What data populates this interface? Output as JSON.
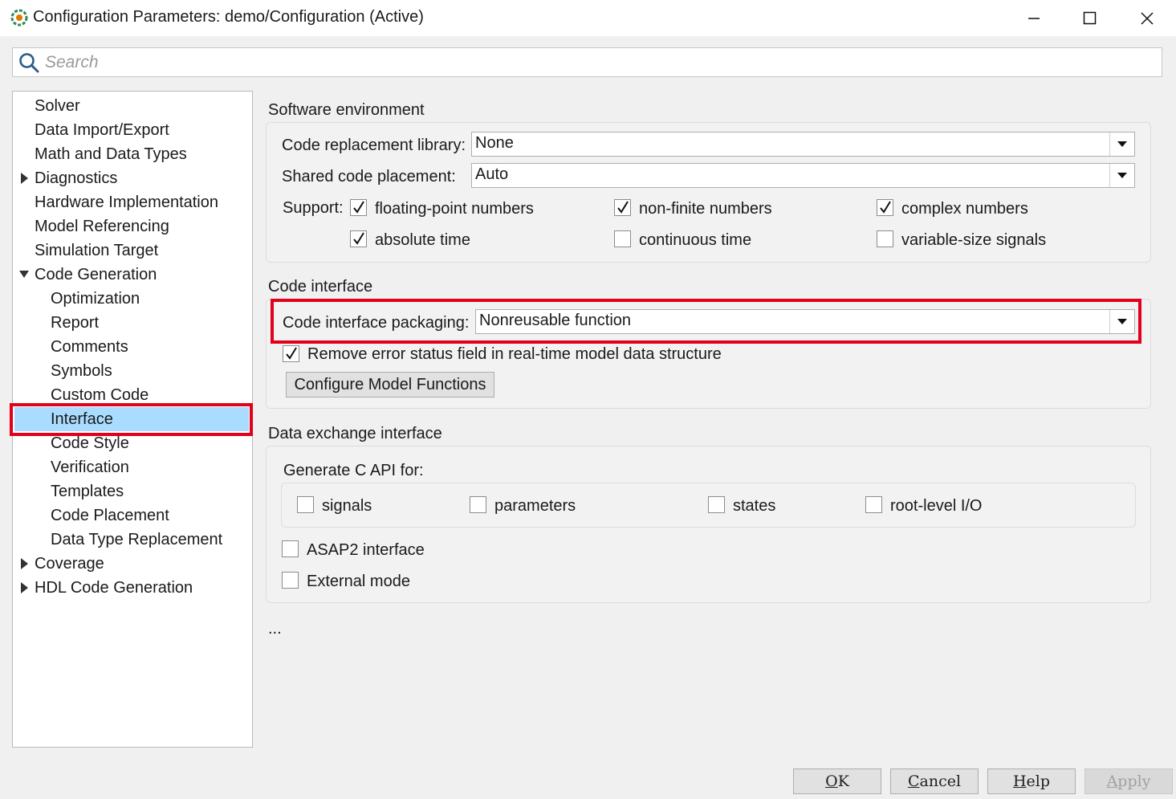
{
  "window": {
    "title": "Configuration Parameters: demo/Configuration (Active)"
  },
  "search": {
    "placeholder": "Search"
  },
  "tree": {
    "items": [
      {
        "label": "Solver"
      },
      {
        "label": "Data Import/Export"
      },
      {
        "label": "Math and Data Types"
      },
      {
        "label": "Diagnostics",
        "expander": "collapsed"
      },
      {
        "label": "Hardware Implementation"
      },
      {
        "label": "Model Referencing"
      },
      {
        "label": "Simulation Target"
      },
      {
        "label": "Code Generation",
        "expander": "expanded"
      },
      {
        "label": "Optimization"
      },
      {
        "label": "Report"
      },
      {
        "label": "Comments"
      },
      {
        "label": "Symbols"
      },
      {
        "label": "Custom Code"
      },
      {
        "label": "Interface",
        "selected": true
      },
      {
        "label": "Code Style"
      },
      {
        "label": "Verification"
      },
      {
        "label": "Templates"
      },
      {
        "label": "Code Placement"
      },
      {
        "label": "Data Type Replacement"
      },
      {
        "label": "Coverage",
        "expander": "collapsed"
      },
      {
        "label": "HDL Code Generation",
        "expander": "collapsed"
      }
    ]
  },
  "software_env": {
    "title": "Software environment",
    "crl_label": "Code replacement library:",
    "crl_value": "None",
    "shared_label": "Shared code placement:",
    "shared_value": "Auto",
    "support_label": "Support:",
    "checkboxes": [
      {
        "label": "floating-point numbers",
        "checked": true
      },
      {
        "label": "non-finite numbers",
        "checked": true
      },
      {
        "label": "complex numbers",
        "checked": true
      },
      {
        "label": "absolute time",
        "checked": true
      },
      {
        "label": "continuous time",
        "checked": false
      },
      {
        "label": "variable-size signals",
        "checked": false
      }
    ]
  },
  "code_interface": {
    "title": "Code interface",
    "packaging_label": "Code interface packaging:",
    "packaging_value": "Nonreusable function",
    "remove_error_label": "Remove error status field in real-time model data structure",
    "remove_error_checked": true,
    "configure_button": "Configure Model Functions"
  },
  "data_exchange": {
    "title": "Data exchange interface",
    "capi_label": "Generate C API for:",
    "capi_options": [
      {
        "label": "signals",
        "checked": false
      },
      {
        "label": "parameters",
        "checked": false
      },
      {
        "label": "states",
        "checked": false
      },
      {
        "label": "root-level I/O",
        "checked": false
      }
    ],
    "asap2_label": "ASAP2 interface",
    "asap2_checked": false,
    "external_label": "External mode",
    "external_checked": false
  },
  "ellipsis": "...",
  "buttons": {
    "ok": {
      "mnemonic": "O",
      "rest": "K"
    },
    "cancel": {
      "mnemonic": "C",
      "rest": "ancel"
    },
    "help": {
      "mnemonic": "H",
      "rest": "elp"
    },
    "apply": {
      "mnemonic": "A",
      "rest": "pply"
    }
  },
  "colors": {
    "selection": "#a9dcff",
    "highlight_border": "#e2001a"
  }
}
